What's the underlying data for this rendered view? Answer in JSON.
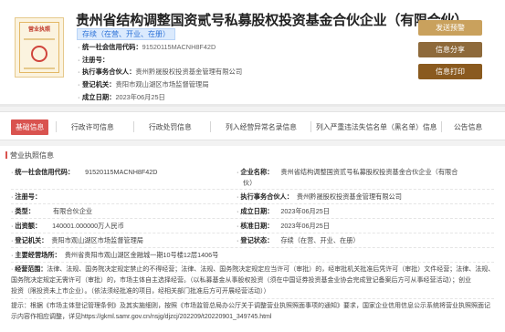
{
  "header": {
    "license_icon_title": "营业执照",
    "company_name": "贵州省结构调整国资贰号私募股权投资基金合伙企业（有限合伙）",
    "status": "存续（在营、开业、在册）",
    "rows": [
      {
        "label": "统一社会信用代码：",
        "value": "91520115MACNH8F42D"
      },
      {
        "label": "注册号：",
        "value": ""
      },
      {
        "label": "执行事务合伙人：",
        "value": "贵州黔晟股权投资基金管理有限公司"
      },
      {
        "label": "登记机关：",
        "value": "贵阳市观山湖区市场监督管理局"
      },
      {
        "label": "成立日期：",
        "value": "2023年06月25日"
      }
    ],
    "buttons": {
      "warn": "发送预警",
      "share": "信息分享",
      "feedback": "信息打印"
    }
  },
  "tabs": [
    {
      "label": "基础信息",
      "active": true
    },
    {
      "label": "行政许可信息"
    },
    {
      "label": "行政处罚信息"
    },
    {
      "label": "列入经营异常名录信息"
    },
    {
      "label": "列入严重违法失信名单（黑名单）信息"
    },
    {
      "label": "公告信息"
    }
  ],
  "section": {
    "title": "营业执照信息",
    "uscc_label": "统一社会信用代码：",
    "uscc_value": "91520115MACNH8F42D",
    "company_label": "企业名称：",
    "company_value_1": "贵州省结构调整国资贰号私募股权投资基金合伙企业（有限合",
    "company_value_2": "伙）",
    "reg_no_label": "注册号：",
    "reg_no_value": "",
    "partner_label": "执行事务合伙人：",
    "partner_value": "贵州黔晟股权投资基金管理有限公司",
    "type_label": "类型：",
    "type_value": "有限合伙企业",
    "setup_label": "成立日期：",
    "setup_value": "2023年06月25日",
    "capital_label": "出资额：",
    "capital_value": "140001.000000万人民币",
    "approve_label": "核准日期：",
    "approve_value": "2023年06月25日",
    "authority_label": "登记机关：",
    "authority_value": "贵阳市观山湖区市场监督管理局",
    "status_label": "登记状态：",
    "status_value": "存续（在营、开业、在册）",
    "address_label": "主要经营场所：",
    "address_value": "贵州省贵阳市观山湖区金融城一期10号楼12层1406号",
    "scope_label": "经营范围：",
    "scope_lines": [
      "法律、法规、国务院决定规定禁止的不得经营；法律、法规、国务院决定规定应当许可（审批）的，经审批机关批准后凭许可（审批）文件经营；法律、法规、",
      "国务院决定规定无需许可（审批）的，市场主体自主选择经营。（以私募基金从事股权投资（须在中国证券投资基金业协会完成登记备案后方可从事经营活动）；创业",
      "投资（限投资未上市企业）。（依法须经批准的项目，经相关部门批准后方可开展经营活动））"
    ],
    "tip_lines": [
      "提示：根据《市场主体登记管理条例》及其实施细则，按照《市场监管总局办公厅关于调整营业执照照面事项的通知》要求，国家企业信用信息公示系统将营业执照照面记",
      "示内容作相应调整，详见https://gkml.samr.gov.cn/nsjg/djzcj/202209/t20220901_349745.html"
    ]
  }
}
